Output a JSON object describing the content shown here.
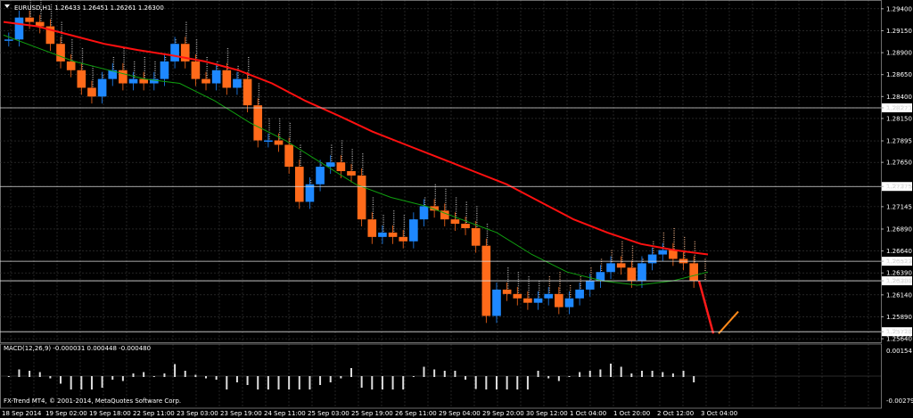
{
  "chart_data": {
    "type": "line",
    "symbol": "EURUSD,H1",
    "ohlc_header": "1.26433 1.26451 1.26261 1.26300",
    "main_price_ticks": [
      1.294,
      1.2915,
      1.289,
      1.2865,
      1.284,
      1.28271,
      1.2815,
      1.27895,
      1.2765,
      1.27375,
      1.27145,
      1.2689,
      1.2664,
      1.26523,
      1.2639,
      1.263,
      1.2614,
      1.2589,
      1.2572,
      1.2564
    ],
    "price_range": [
      1.256,
      1.295
    ],
    "marked_levels": [
      1.28271,
      1.27375,
      1.26523,
      1.263,
      1.2572
    ],
    "time_labels": [
      "18 Sep 2014",
      "19 Sep 02:00",
      "19 Sep 18:00",
      "22 Sep 11:00",
      "23 Sep 03:00",
      "23 Sep 19:00",
      "24 Sep 11:00",
      "25 Sep 03:00",
      "25 Sep 19:00",
      "26 Sep 11:00",
      "29 Sep 04:00",
      "29 Sep 20:00",
      "30 Sep 12:00",
      "1 Oct 04:00",
      "1 Oct 20:00",
      "2 Oct 12:00",
      "3 Oct 04:00"
    ],
    "close_series": [
      1.2905,
      1.293,
      1.2925,
      1.292,
      1.29,
      1.288,
      1.287,
      1.285,
      1.284,
      1.286,
      1.287,
      1.2855,
      1.286,
      1.2855,
      1.286,
      1.288,
      1.29,
      1.288,
      1.286,
      1.2855,
      1.287,
      1.285,
      1.286,
      1.283,
      1.279,
      1.279,
      1.2785,
      1.276,
      1.272,
      1.274,
      1.276,
      1.2765,
      1.2755,
      1.275,
      1.27,
      1.268,
      1.2685,
      1.268,
      1.2675,
      1.27,
      1.2715,
      1.271,
      1.27,
      1.2695,
      1.269,
      1.267,
      1.259,
      1.262,
      1.2615,
      1.261,
      1.2605,
      1.261,
      1.2615,
      1.26,
      1.261,
      1.262,
      1.263,
      1.264,
      1.265,
      1.2645,
      1.263,
      1.265,
      1.266,
      1.2665,
      1.2655,
      1.265,
      1.263
    ],
    "ma_red_series": [
      1.2925,
      1.292,
      1.291,
      1.29,
      1.2893,
      1.2887,
      1.288,
      1.287,
      1.2855,
      1.2835,
      1.2818,
      1.28,
      1.2785,
      1.277,
      1.2755,
      1.274,
      1.272,
      1.27,
      1.2685,
      1.2672,
      1.2665,
      1.266
    ],
    "ma_green_series": [
      1.291,
      1.2895,
      1.288,
      1.287,
      1.286,
      1.2855,
      1.2835,
      1.281,
      1.279,
      1.2765,
      1.274,
      1.2725,
      1.2715,
      1.27,
      1.2685,
      1.266,
      1.264,
      1.263,
      1.2625,
      1.263,
      1.264
    ],
    "forecast_down_to": 1.257,
    "macd_label": "MACD(12,26,9) -0.000031 0.000448 -0.000480",
    "macd_ticks": [
      "0.00154",
      "-0.002791"
    ],
    "footer": "FX-Trend MT4, © 2001-2014, MetaQuotes Software Corp.",
    "colors": {
      "bull": "#1e88ff",
      "bear": "#ff6a1a",
      "ma_slow": "#ff1010",
      "ma_fast": "#10a010",
      "grid": "#3a3a3a"
    }
  }
}
